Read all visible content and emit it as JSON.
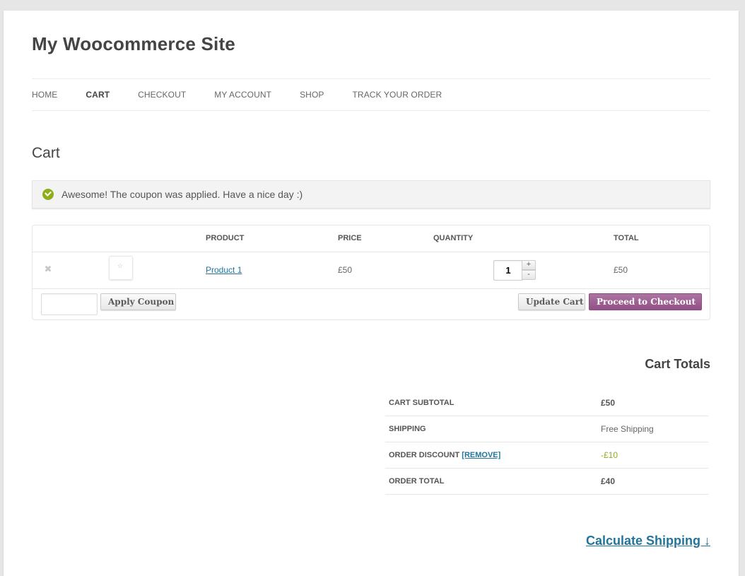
{
  "site": {
    "title": "My Woocommerce Site"
  },
  "nav": {
    "items": [
      {
        "label": "HOME"
      },
      {
        "label": "CART"
      },
      {
        "label": "CHECKOUT"
      },
      {
        "label": "MY ACCOUNT"
      },
      {
        "label": "SHOP"
      },
      {
        "label": "TRACK YOUR ORDER"
      }
    ],
    "active": "CART"
  },
  "page": {
    "title": "Cart"
  },
  "notice": {
    "message": "Awesome! The coupon was applied. Have a nice day :)",
    "icon": "check-circle-icon",
    "color": "#8fae1b"
  },
  "cart": {
    "headers": {
      "product": "PRODUCT",
      "price": "PRICE",
      "quantity": "QUANTITY",
      "total": "TOTAL"
    },
    "items": [
      {
        "remove": "✖",
        "product": "Product 1",
        "price": "£50",
        "quantity": "1",
        "total": "£50"
      }
    ],
    "coupon": {
      "value": "",
      "placeholder": ""
    },
    "buttons": {
      "apply_coupon": "Apply Coupon",
      "update_cart": "Update Cart",
      "checkout": "Proceed to Checkout",
      "checkout_arrow": "›"
    }
  },
  "totals": {
    "title": "Cart Totals",
    "rows": [
      {
        "label": "CART SUBTOTAL",
        "value": "£50"
      },
      {
        "label": "SHIPPING",
        "value": "Free Shipping"
      },
      {
        "label": "ORDER DISCOUNT",
        "link": "[REMOVE]",
        "value": "-£10"
      },
      {
        "label": "ORDER TOTAL",
        "value": "£40"
      }
    ]
  },
  "calculate_shipping": "Calculate Shipping ↓",
  "colors": {
    "link": "#21759b",
    "checkout_button": "#a0649a",
    "discount": "#8fae1b"
  }
}
